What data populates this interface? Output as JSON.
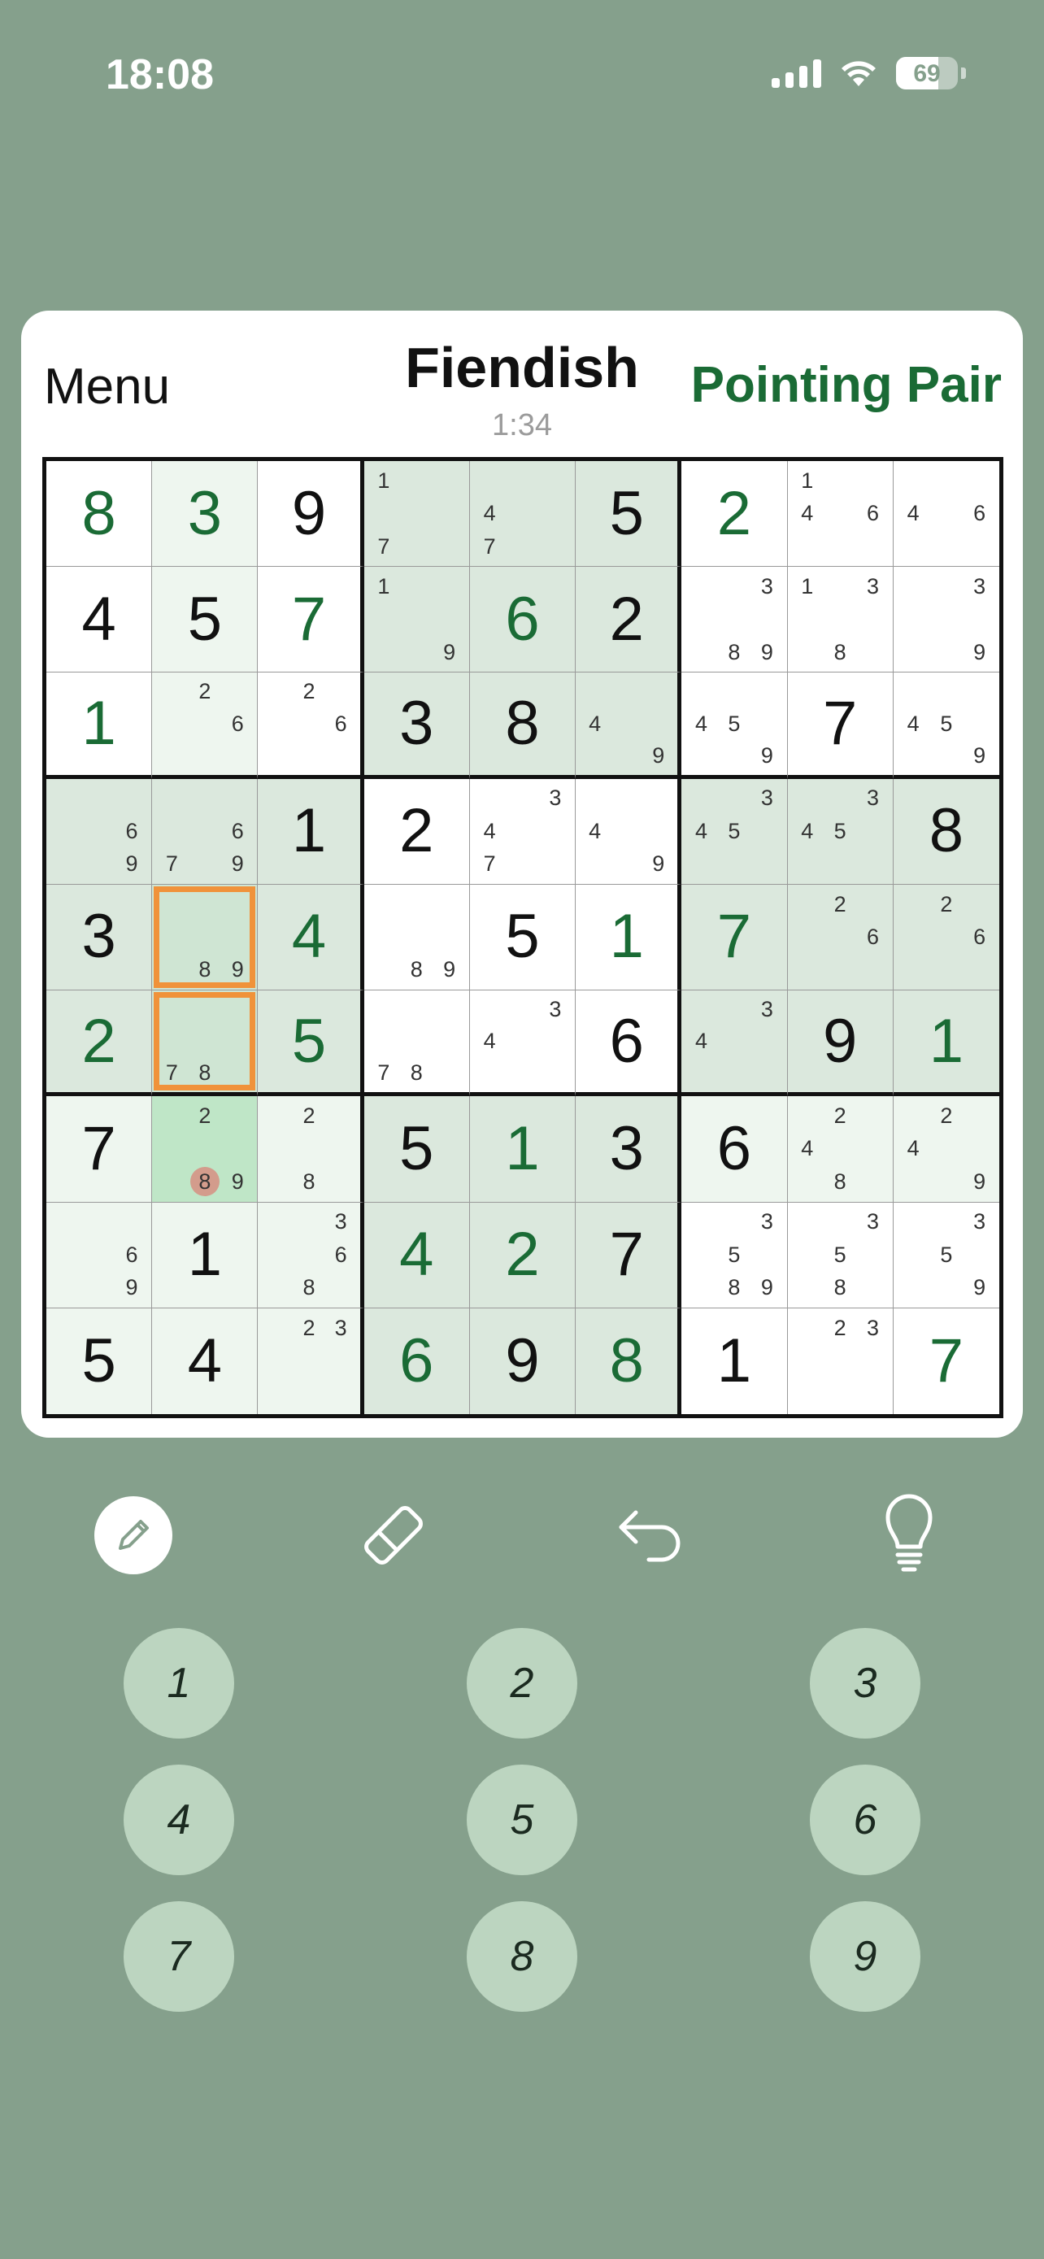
{
  "status_bar": {
    "time": "18:08",
    "battery": "69",
    "battery_level": 0.69
  },
  "header": {
    "menu_label": "Menu",
    "title": "Fiendish",
    "timer": "1:34",
    "technique": "Pointing Pair"
  },
  "colors": {
    "background": "#85a08c",
    "accent": "#1a6b35",
    "selection": "#f0923a"
  },
  "cells": [
    [
      {
        "v": "8",
        "t": "user"
      },
      {
        "v": "3",
        "t": "user"
      },
      {
        "v": "9",
        "t": "given"
      },
      {
        "n": [
          "1",
          "",
          "",
          "",
          "",
          "",
          "7",
          "",
          ""
        ]
      },
      {
        "n": [
          "",
          "",
          "",
          "4",
          "",
          "",
          "7",
          "",
          ""
        ]
      },
      {
        "v": "5",
        "t": "given"
      },
      {
        "v": "2",
        "t": "user"
      },
      {
        "n": [
          "1",
          "",
          "",
          "4",
          "",
          "6",
          "",
          "",
          ""
        ]
      },
      {
        "n": [
          "",
          "",
          "",
          "4",
          "",
          "6",
          "",
          "",
          ""
        ]
      }
    ],
    [
      {
        "v": "4",
        "t": "given"
      },
      {
        "v": "5",
        "t": "given"
      },
      {
        "v": "7",
        "t": "user"
      },
      {
        "n": [
          "1",
          "",
          "",
          "",
          "",
          "",
          "",
          "",
          "9"
        ]
      },
      {
        "v": "6",
        "t": "user"
      },
      {
        "v": "2",
        "t": "given"
      },
      {
        "n": [
          "",
          "",
          "3",
          "",
          "",
          "",
          "",
          "8",
          "9"
        ]
      },
      {
        "n": [
          "1",
          "",
          "3",
          "",
          "",
          "",
          "",
          "8",
          ""
        ]
      },
      {
        "n": [
          "",
          "",
          "3",
          "",
          "",
          "",
          "",
          "",
          "9"
        ]
      }
    ],
    [
      {
        "v": "1",
        "t": "user"
      },
      {
        "n": [
          "",
          "2",
          "",
          "",
          "",
          "6",
          "",
          "",
          ""
        ]
      },
      {
        "n": [
          "",
          "2",
          "",
          "",
          "",
          "6",
          "",
          "",
          ""
        ]
      },
      {
        "v": "3",
        "t": "given"
      },
      {
        "v": "8",
        "t": "given"
      },
      {
        "n": [
          "",
          "",
          "",
          "4",
          "",
          "",
          "",
          "",
          "9"
        ]
      },
      {
        "n": [
          "",
          "",
          "",
          "4",
          "5",
          "",
          "",
          "",
          "9"
        ]
      },
      {
        "v": "7",
        "t": "given"
      },
      {
        "n": [
          "",
          "",
          "",
          "4",
          "5",
          "",
          "",
          "",
          "9"
        ]
      }
    ],
    [
      {
        "n": [
          "",
          "",
          "",
          "",
          "",
          "6",
          "",
          "",
          "9"
        ]
      },
      {
        "n": [
          "",
          "",
          "",
          "",
          "",
          "6",
          "7",
          "",
          "9"
        ]
      },
      {
        "v": "1",
        "t": "given"
      },
      {
        "v": "2",
        "t": "given"
      },
      {
        "n": [
          "",
          "",
          "3",
          "4",
          "",
          "",
          "7",
          "",
          ""
        ]
      },
      {
        "n": [
          "",
          "",
          "",
          "4",
          "",
          "",
          "",
          "",
          "9"
        ]
      },
      {
        "n": [
          "",
          "",
          "3",
          "4",
          "5",
          "",
          "",
          "",
          ""
        ]
      },
      {
        "n": [
          "",
          "",
          "3",
          "4",
          "5",
          "",
          "",
          "",
          ""
        ]
      },
      {
        "v": "8",
        "t": "given"
      }
    ],
    [
      {
        "v": "3",
        "t": "given"
      },
      {
        "n": [
          "",
          "",
          "",
          "",
          "",
          "",
          "",
          "8",
          "9"
        ]
      },
      {
        "v": "4",
        "t": "user"
      },
      {
        "n": [
          "",
          "",
          "",
          "",
          "",
          "",
          "",
          "8",
          "9"
        ]
      },
      {
        "v": "5",
        "t": "given"
      },
      {
        "v": "1",
        "t": "user"
      },
      {
        "v": "7",
        "t": "user"
      },
      {
        "n": [
          "",
          "2",
          "",
          "",
          "",
          "6",
          "",
          "",
          ""
        ]
      },
      {
        "n": [
          "",
          "2",
          "",
          "",
          "",
          "6",
          "",
          "",
          ""
        ]
      }
    ],
    [
      {
        "v": "2",
        "t": "user"
      },
      {
        "n": [
          "",
          "",
          "",
          "",
          "",
          "",
          "7",
          "8",
          ""
        ]
      },
      {
        "v": "5",
        "t": "user"
      },
      {
        "n": [
          "",
          "",
          "",
          "",
          "",
          "",
          "7",
          "8",
          ""
        ]
      },
      {
        "n": [
          "",
          "",
          "3",
          "4",
          "",
          "",
          "",
          "",
          ""
        ]
      },
      {
        "v": "6",
        "t": "given"
      },
      {
        "n": [
          "",
          "",
          "3",
          "4",
          "",
          "",
          "",
          "",
          ""
        ]
      },
      {
        "v": "9",
        "t": "given"
      },
      {
        "v": "1",
        "t": "user"
      }
    ],
    [
      {
        "v": "7",
        "t": "given"
      },
      {
        "n": [
          "",
          "2",
          "",
          "",
          "",
          "",
          "",
          "8",
          "9"
        ]
      },
      {
        "n": [
          "",
          "2",
          "",
          "",
          "",
          "",
          "",
          "8",
          ""
        ]
      },
      {
        "v": "5",
        "t": "given"
      },
      {
        "v": "1",
        "t": "user"
      },
      {
        "v": "3",
        "t": "given"
      },
      {
        "v": "6",
        "t": "given"
      },
      {
        "n": [
          "",
          "2",
          "",
          "4",
          "",
          "",
          "",
          "8",
          ""
        ]
      },
      {
        "n": [
          "",
          "2",
          "",
          "4",
          "",
          "",
          "",
          "",
          "9"
        ]
      }
    ],
    [
      {
        "n": [
          "",
          "",
          "",
          "",
          "",
          "6",
          "",
          "",
          "9"
        ]
      },
      {
        "v": "1",
        "t": "given"
      },
      {
        "n": [
          "",
          "",
          "3",
          "",
          "",
          "6",
          "",
          "8",
          ""
        ]
      },
      {
        "v": "4",
        "t": "user"
      },
      {
        "v": "2",
        "t": "user"
      },
      {
        "v": "7",
        "t": "given"
      },
      {
        "n": [
          "",
          "",
          "3",
          "",
          "5",
          "",
          "",
          "8",
          "9"
        ]
      },
      {
        "n": [
          "",
          "",
          "3",
          "",
          "5",
          "",
          "",
          "8",
          ""
        ]
      },
      {
        "n": [
          "",
          "",
          "3",
          "",
          "5",
          "",
          "",
          "",
          "9"
        ]
      }
    ],
    [
      {
        "v": "5",
        "t": "given"
      },
      {
        "v": "4",
        "t": "given"
      },
      {
        "n": [
          "",
          "2",
          "3",
          "",
          "",
          "",
          "",
          "",
          ""
        ]
      },
      {
        "v": "6",
        "t": "user"
      },
      {
        "v": "9",
        "t": "given"
      },
      {
        "v": "8",
        "t": "user"
      },
      {
        "v": "1",
        "t": "given"
      },
      {
        "n": [
          "",
          "2",
          "3",
          "",
          "",
          "",
          "",
          "",
          ""
        ]
      },
      {
        "v": "7",
        "t": "user"
      }
    ]
  ],
  "toolbar": {
    "pencil": "pencil-icon",
    "eraser": "eraser-icon",
    "undo": "undo-icon",
    "hint": "lightbulb-icon"
  },
  "keypad": [
    "1",
    "2",
    "3",
    "4",
    "5",
    "6",
    "7",
    "8",
    "9"
  ]
}
